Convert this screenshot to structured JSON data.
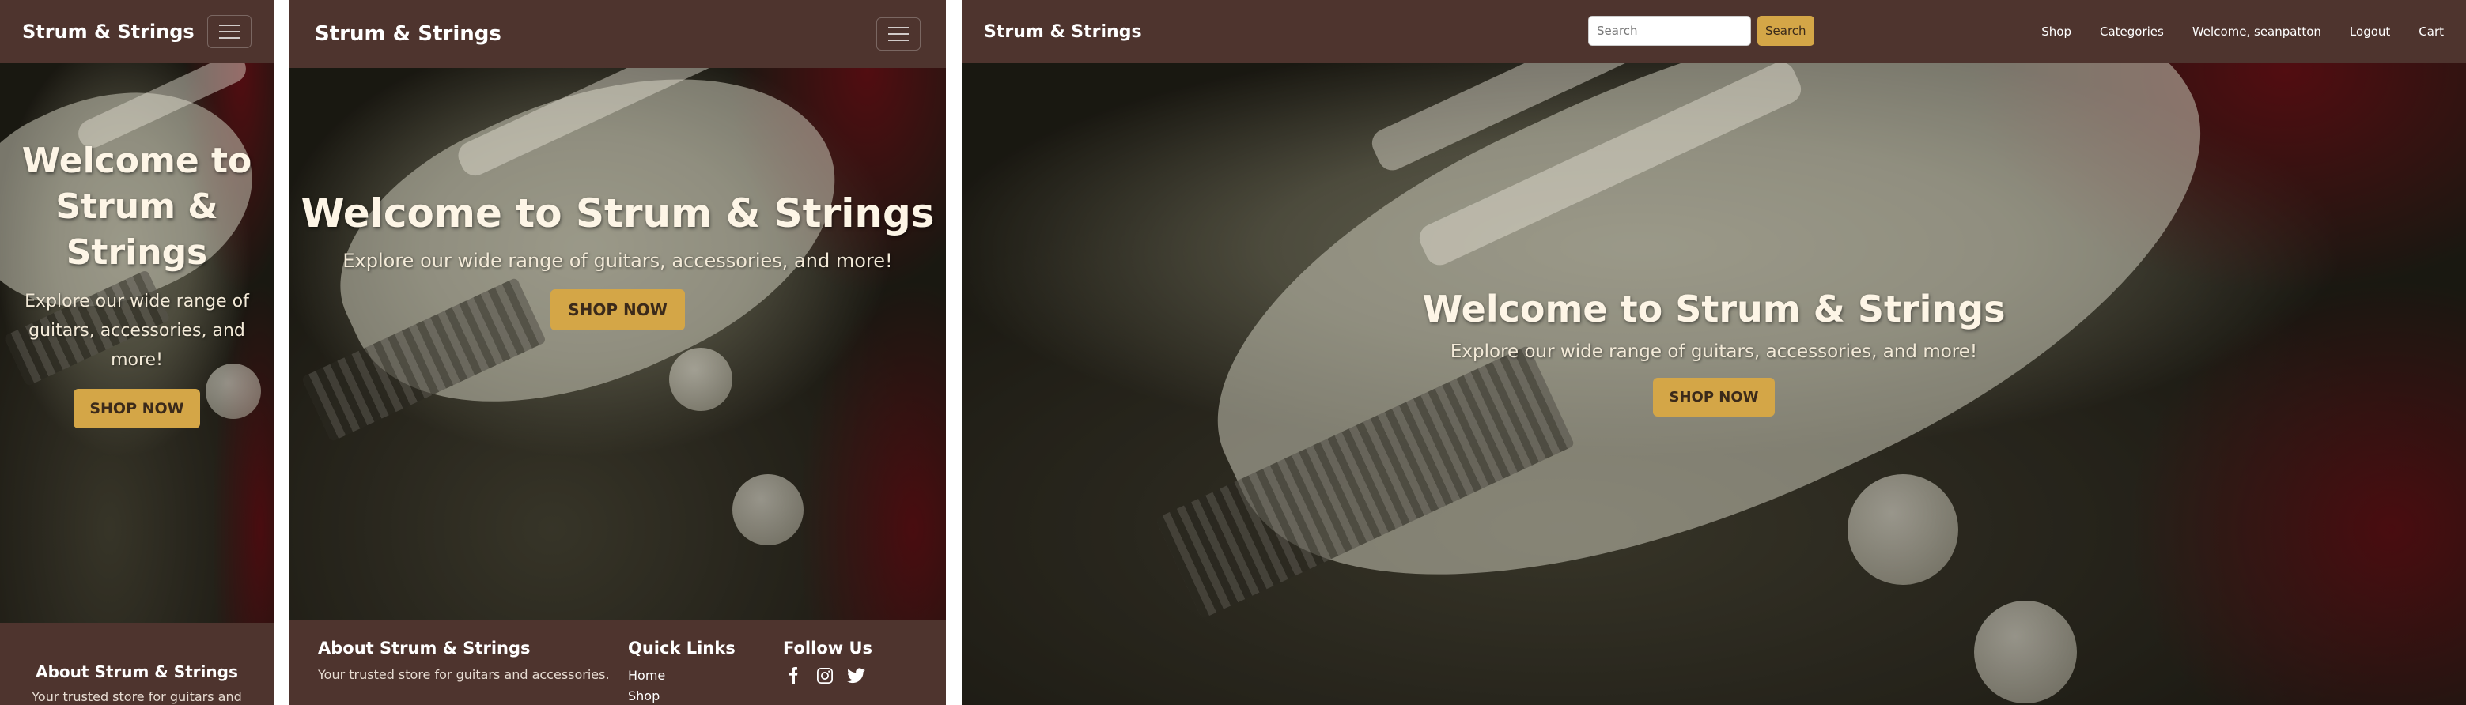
{
  "site": {
    "brand": "Strum & Strings"
  },
  "search": {
    "placeholder": "Search",
    "button_label": "Search"
  },
  "nav": {
    "links": [
      "Shop",
      "Categories",
      "Welcome, seanpatton",
      "Logout",
      "Cart"
    ]
  },
  "hero": {
    "title": "Welcome to Strum & Strings",
    "subtitle": "Explore our wide range of guitars, accessories, and more!",
    "cta_label": "SHOP NOW"
  },
  "footer": {
    "about_title": "About Strum & Strings",
    "about_text": "Your trusted store for guitars and accessories.",
    "about_text_truncated": "Your trusted store for guitars and",
    "quick_links_title": "Quick Links",
    "quick_links": [
      "Home",
      "Shop"
    ],
    "follow_title": "Follow Us",
    "social_icons": [
      "facebook-icon",
      "instagram-icon",
      "twitter-icon"
    ]
  },
  "colors": {
    "navbar_bg": "#4e342e",
    "accent": "#d4a647",
    "hero_text": "#fdf5e6"
  }
}
